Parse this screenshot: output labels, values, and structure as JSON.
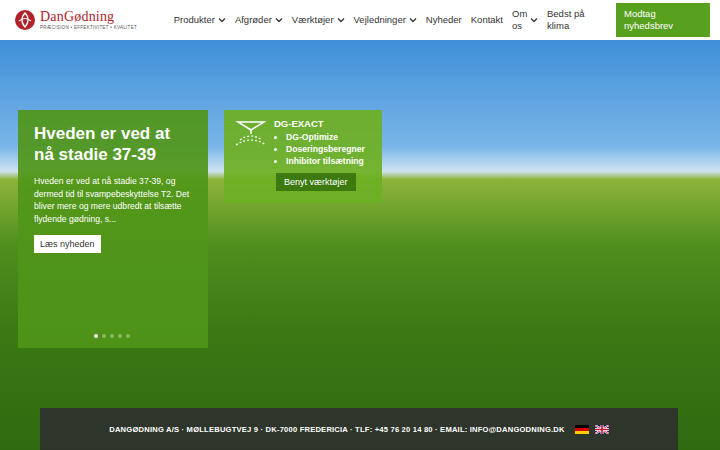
{
  "header": {
    "brand": "DanGødning",
    "tagline": "PRÆCISION • EFFEKTIVITET • KVALITET",
    "nav": [
      {
        "label": "Produkter",
        "dropdown": true,
        "wrap": false
      },
      {
        "label": "Afgrøder",
        "dropdown": true,
        "wrap": false
      },
      {
        "label": "Værktøjer",
        "dropdown": true,
        "wrap": false
      },
      {
        "label": "Vejledninger",
        "dropdown": true,
        "wrap": false
      },
      {
        "label": "Nyheder",
        "dropdown": false,
        "wrap": false
      },
      {
        "label": "Kontakt",
        "dropdown": false,
        "wrap": false
      },
      {
        "label": "Om os",
        "dropdown": true,
        "wrap": true
      },
      {
        "label": "Bedst på klima",
        "dropdown": false,
        "wrap": true
      }
    ],
    "cta": "Modtag nyhedsbrev"
  },
  "news_card": {
    "title": "Hveden er ved at nå stadie 37-39",
    "text": "Hveden er ved at nå stadie 37-39, og dermed tid til svampebeskyttelse T2. Det bliver mere og mere udbredt at tilsætte flydende gødning, s...",
    "button": "Læs nyheden",
    "dots": [
      {
        "selected": true
      },
      {
        "selected": false
      },
      {
        "selected": false
      },
      {
        "selected": false
      },
      {
        "selected": false
      }
    ]
  },
  "tool_card": {
    "title": "DG-EXACT",
    "items": [
      "DG-Optimize",
      "Doseringsberegner",
      "Inhibitor tilsætning"
    ],
    "button": "Benyt værktøjer"
  },
  "footer": {
    "text": "DANGØDNING A/S · MØLLEBUGTVEJ 9 · DK-7000 FREDERICIA · TLF: +45 76 20 14 80 · EMAIL: INFO@DANGODNING.DK"
  }
}
